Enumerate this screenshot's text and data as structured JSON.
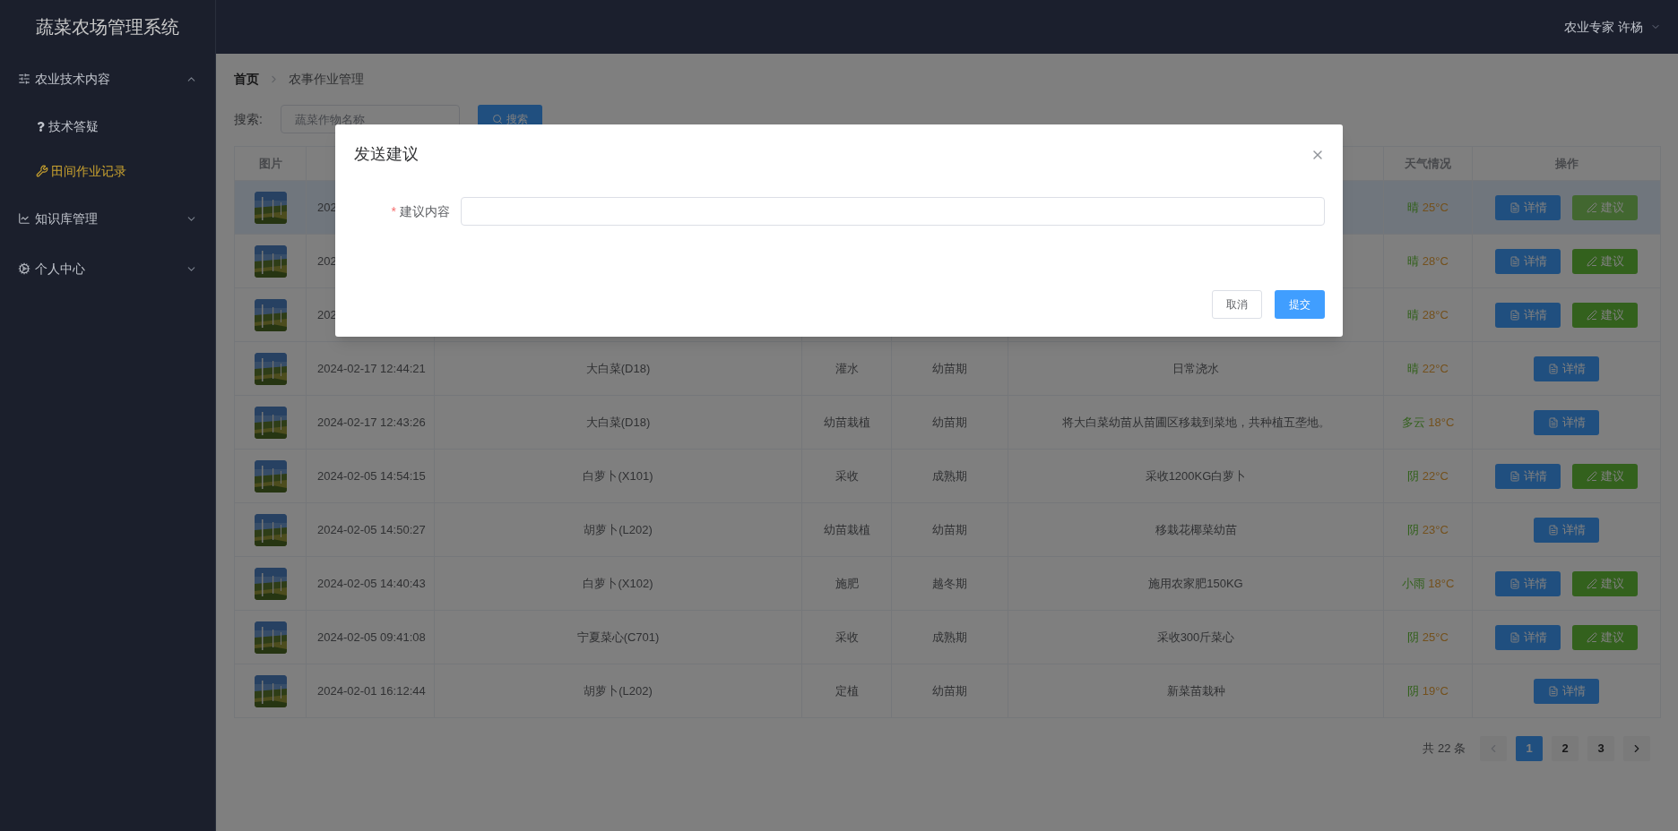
{
  "sidebar": {
    "title": "蔬菜农场管理系统",
    "items": [
      {
        "label": "农业技术内容",
        "expanded": true,
        "children": [
          {
            "label": "技术答疑",
            "selected": false
          },
          {
            "label": "田间作业记录",
            "selected": true
          }
        ]
      },
      {
        "label": "知识库管理",
        "expanded": false
      },
      {
        "label": "个人中心",
        "expanded": false
      }
    ]
  },
  "header": {
    "user": "农业专家 许杨"
  },
  "breadcrumb": [
    {
      "label": "首页",
      "kind": "link"
    },
    {
      "label": "农事作业管理",
      "kind": "current"
    }
  ],
  "search": {
    "label": "搜索:",
    "placeholder": "蔬菜作物名称",
    "button": "搜索"
  },
  "table": {
    "headers": {
      "image": "图片",
      "weather": "天气情况",
      "actions": "操作"
    },
    "rows": [
      {
        "highlighted": true,
        "date": "202",
        "weather": {
          "condition": "晴",
          "temperature": "25°C"
        },
        "actions": [
          {
            "kind": "detail",
            "label": "详情"
          },
          {
            "kind": "suggest",
            "label": "建议"
          }
        ]
      },
      {
        "highlighted": false,
        "date": "202",
        "weather": {
          "condition": "晴",
          "temperature": "28°C"
        },
        "actions": [
          {
            "kind": "detail",
            "label": "详情"
          },
          {
            "kind": "suggest",
            "label": "建议"
          }
        ]
      },
      {
        "highlighted": false,
        "date": "202",
        "weather": {
          "condition": "晴",
          "temperature": "28°C"
        },
        "actions": [
          {
            "kind": "detail",
            "label": "详情"
          },
          {
            "kind": "suggest",
            "label": "建议"
          }
        ]
      },
      {
        "highlighted": false,
        "date": "2024-02-17 12:44:21",
        "crop": "大白菜(D18)",
        "operation": "灌水",
        "stage": "幼苗期",
        "description": "日常浇水",
        "weather": {
          "condition": "晴",
          "temperature": "22°C"
        },
        "actions": [
          {
            "kind": "detail",
            "label": "详情"
          }
        ]
      },
      {
        "highlighted": false,
        "date": "2024-02-17 12:43:26",
        "crop": "大白菜(D18)",
        "operation": "幼苗栽植",
        "stage": "幼苗期",
        "description": "将大白菜幼苗从苗圃区移栽到菜地，共种植五垄地。",
        "weather": {
          "condition": "多云",
          "temperature": "18°C"
        },
        "actions": [
          {
            "kind": "detail",
            "label": "详情"
          }
        ]
      },
      {
        "highlighted": false,
        "date": "2024-02-05 14:54:15",
        "crop": "白萝卜(X101)",
        "operation": "采收",
        "stage": "成熟期",
        "description": "采收1200KG白萝卜",
        "weather": {
          "condition": "阴",
          "temperature": "22°C"
        },
        "actions": [
          {
            "kind": "detail",
            "label": "详情"
          },
          {
            "kind": "suggest",
            "label": "建议"
          }
        ]
      },
      {
        "highlighted": false,
        "date": "2024-02-05 14:50:27",
        "crop": "胡萝卜(L202)",
        "operation": "幼苗栽植",
        "stage": "幼苗期",
        "description": "移栽花椰菜幼苗",
        "weather": {
          "condition": "阴",
          "temperature": "23°C"
        },
        "actions": [
          {
            "kind": "detail",
            "label": "详情"
          }
        ]
      },
      {
        "highlighted": false,
        "date": "2024-02-05 14:40:43",
        "crop": "白萝卜(X102)",
        "operation": "施肥",
        "stage": "越冬期",
        "description": "施用农家肥150KG",
        "weather": {
          "condition": "小雨",
          "temperature": "18°C"
        },
        "actions": [
          {
            "kind": "detail",
            "label": "详情"
          },
          {
            "kind": "suggest",
            "label": "建议"
          }
        ]
      },
      {
        "highlighted": false,
        "date": "2024-02-05 09:41:08",
        "crop": "宁夏菜心(C701)",
        "operation": "采收",
        "stage": "成熟期",
        "description": "采收300斤菜心",
        "weather": {
          "condition": "阴",
          "temperature": "25°C"
        },
        "actions": [
          {
            "kind": "detail",
            "label": "详情"
          },
          {
            "kind": "suggest",
            "label": "建议"
          }
        ]
      },
      {
        "highlighted": false,
        "date": "2024-02-01 16:12:44",
        "crop": "胡萝卜(L202)",
        "operation": "定植",
        "stage": "幼苗期",
        "description": "新菜苗栽种",
        "weather": {
          "condition": "阴",
          "temperature": "19°C"
        },
        "actions": [
          {
            "kind": "detail",
            "label": "详情"
          }
        ]
      }
    ]
  },
  "pagination": {
    "total": "共 22 条",
    "prev": {
      "disabled": true
    },
    "next": {
      "disabled": false
    },
    "pages": [
      {
        "label": "1",
        "selected": true
      },
      {
        "label": "2",
        "selected": false
      },
      {
        "label": "3",
        "selected": false
      }
    ]
  },
  "dialog": {
    "title": "发送建议",
    "field": {
      "required_mark": "*",
      "label": "建议内容"
    },
    "buttons": [
      {
        "kind": "cancel",
        "label": "取消"
      },
      {
        "kind": "submit",
        "label": "提交"
      }
    ]
  }
}
